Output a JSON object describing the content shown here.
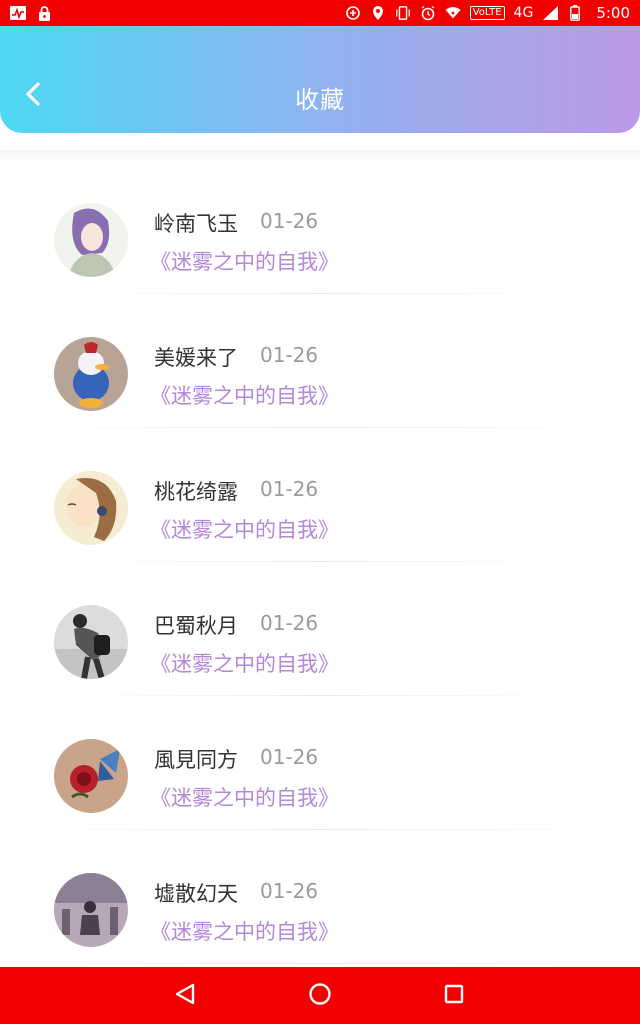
{
  "status_bar": {
    "time": "5:00",
    "network": "4G",
    "volte": "VoLTE",
    "icons": [
      "activity-icon",
      "lock-icon",
      "data-saver-icon",
      "location-icon",
      "vibrate-icon",
      "alarm-icon",
      "wifi-icon",
      "signal-icon",
      "battery-icon"
    ]
  },
  "header": {
    "title": "收藏",
    "back_icon": "chevron-left-icon",
    "gradient": [
      "#4dd8f3",
      "#8fb3ee",
      "#bc98e9"
    ]
  },
  "favorites": [
    {
      "name": "岭南飞玉",
      "date": "01-26",
      "book": "《迷雾之中的自我》"
    },
    {
      "name": "美媛来了",
      "date": "01-26",
      "book": "《迷雾之中的自我》"
    },
    {
      "name": "桃花绮露",
      "date": "01-26",
      "book": "《迷雾之中的自我》"
    },
    {
      "name": "巴蜀秋月",
      "date": "01-26",
      "book": "《迷雾之中的自我》"
    },
    {
      "name": "風見同方",
      "date": "01-26",
      "book": "《迷雾之中的自我》"
    },
    {
      "name": "墟散幻天",
      "date": "01-26",
      "book": "《迷雾之中的自我》"
    }
  ],
  "colors": {
    "status_bar": "#f20000",
    "book_title": "#b487d8",
    "name": "#333333",
    "date": "#9a9a9a"
  },
  "nav_bar": {
    "icons": [
      "back-triangle-icon",
      "home-circle-icon",
      "recents-square-icon"
    ]
  }
}
